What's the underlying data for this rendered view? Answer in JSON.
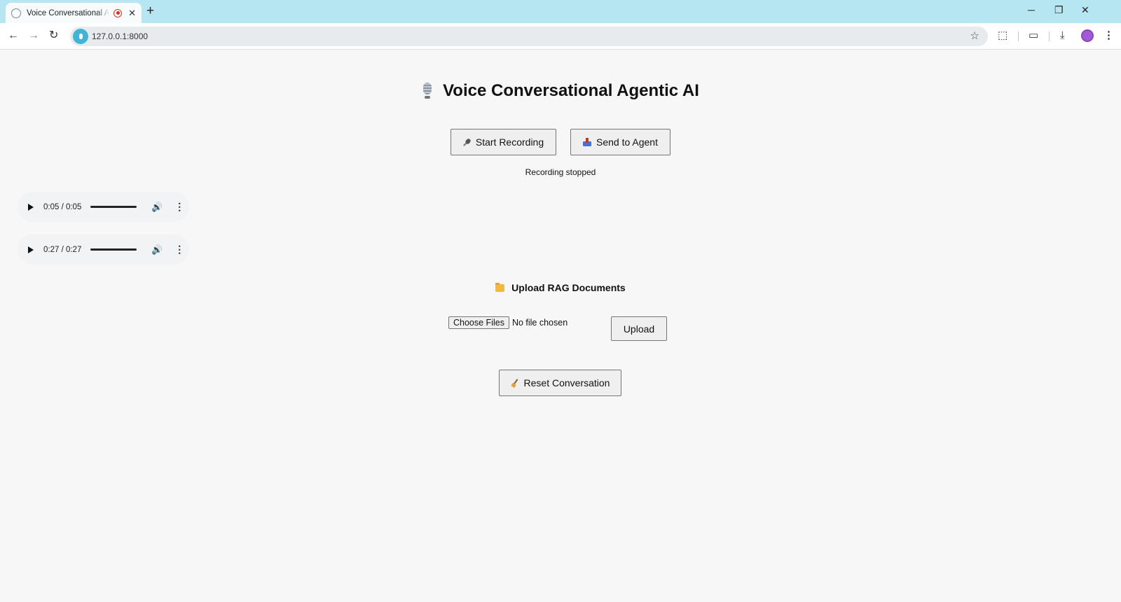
{
  "browser": {
    "tab_title": "Voice Conversational Agent",
    "tab_close": "✕",
    "new_tab": "+",
    "url": "127.0.0.1:8000",
    "window_controls": {
      "minimize": "─",
      "restore": "❐",
      "close": "✕"
    },
    "nav": {
      "back": "←",
      "forward": "→",
      "reload": "↻"
    },
    "toolbar_icons": {
      "star": "☆",
      "extensions": "⬚",
      "tab_search": "▭",
      "download": "⤓",
      "menu": "⋮"
    }
  },
  "page": {
    "title": "Voice Conversational Agentic AI",
    "buttons": {
      "start_recording": "Start Recording",
      "send_to_agent": "Send to Agent",
      "upload": "Upload",
      "reset_conversation": "Reset Conversation"
    },
    "status": "Recording stopped",
    "audio_players": [
      {
        "time": "0:05 / 0:05",
        "volume_icon": "🔊",
        "menu_icon": "⋮"
      },
      {
        "time": "0:27 / 0:27",
        "volume_icon": "🔊",
        "menu_icon": "⋮"
      }
    ],
    "upload_section": {
      "heading": "Upload RAG Documents",
      "choose_files": "Choose Files",
      "no_file": "No file chosen"
    }
  },
  "colors": {
    "tabstrip": "#b5e6f2",
    "page_bg": "#f7f7f7",
    "recording_indicator": "#d93025"
  }
}
